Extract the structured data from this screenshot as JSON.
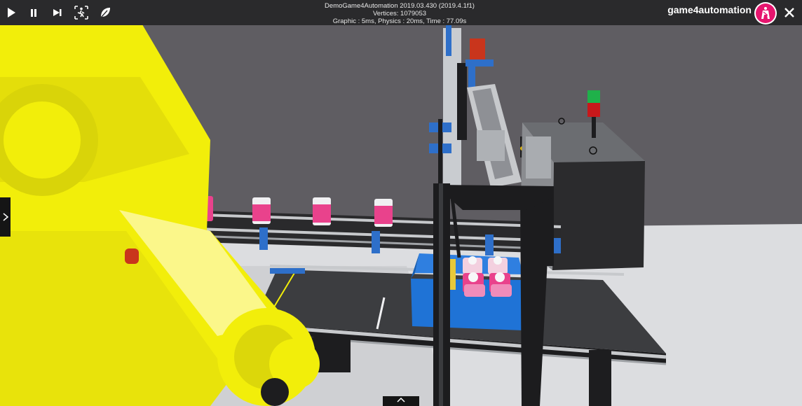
{
  "app": {
    "title": "DemoGame4Automation 2019.03.430 (2019.4.1f1)",
    "vertices": "Vertices: 1079053",
    "stats": "Graphic : 5ms, Physics : 20ms, Time : 77.09s",
    "brand": "game4automation"
  },
  "toolbar": {
    "icons": [
      "play-icon",
      "pause-icon",
      "step-forward-icon",
      "exit-person-icon",
      "leaf-icon"
    ]
  },
  "colors": {
    "robot": "#f2ee0a",
    "can": "#e9428c",
    "crate": "#1f73d6",
    "frame": "#1c1c1e",
    "light_green": "#1fb14a",
    "light_red": "#c8181b",
    "brand_logo": "#e6156e"
  }
}
